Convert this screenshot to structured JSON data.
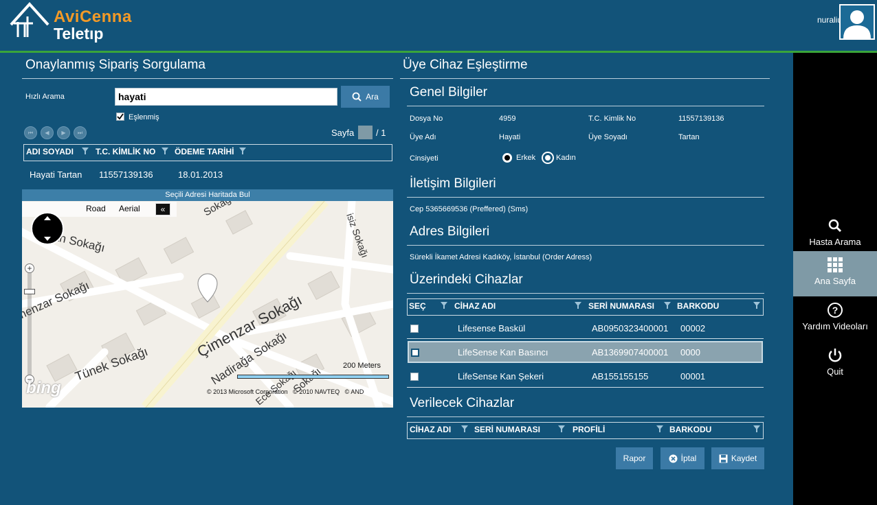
{
  "app": {
    "logo_top": "AviCenna",
    "logo_bottom": "Teletıp",
    "username": "nuraliu"
  },
  "sidebar": {
    "items": [
      {
        "label": "Hasta Arama",
        "icon": "search-icon"
      },
      {
        "label": "Ana Sayfa",
        "icon": "grid-icon",
        "active": true
      },
      {
        "label": "Yardım Videoları",
        "icon": "help-icon"
      },
      {
        "label": "Quit",
        "icon": "power-icon"
      }
    ]
  },
  "left": {
    "title": "Onaylanmış Sipariş Sorgulama",
    "quick_search_label": "Hızlı Arama",
    "search_value": "hayati",
    "search_button": "Ara",
    "matched_label": "Eşlenmiş",
    "page_label": "Sayfa",
    "page_total": "/ 1",
    "columns": [
      "ADI SOYADI",
      "T.C. KİMLİK NO",
      "ÖDEME TARİHİ"
    ],
    "rows": [
      {
        "name": "Hayati Tartan",
        "tc": "11557139136",
        "date": "18.01.2013"
      }
    ]
  },
  "map": {
    "header": "Seçili Adresi Haritada Bul",
    "road": "Road",
    "aerial": "Aerial",
    "collapse": "«",
    "streets": [
      "Çimenzar Sokağı",
      "Tünek Sokağı",
      "Nadirağa Sokağı",
      "Celtan Sokağı",
      "Cimenzar Sokağı",
      "Sokağı",
      "Sokağı",
      "isiz Sokağı",
      "Ece Sokağı"
    ],
    "scale": "200 Meters",
    "copyright": "© 2013 Microsoft Corporation   © 2010 NAVTEQ   © AND",
    "bing": "bing"
  },
  "right": {
    "title": "Üye Cihaz Eşleştirme",
    "general": {
      "title": "Genel Bilgiler",
      "dosya_label": "Dosya No",
      "dosya": "4959",
      "tc_label": "T.C. Kimlik No",
      "tc": "11557139136",
      "ad_label": "Üye Adı",
      "ad": "Hayati",
      "soyad_label": "Üye Soyadı",
      "soyad": "Tartan",
      "cins_label": "Cinsiyeti",
      "erkek": "Erkek",
      "kadin": "Kadın"
    },
    "contact": {
      "title": "İletişim Bilgileri",
      "line": "Cep  5365669536 (Preffered) (Sms)"
    },
    "address": {
      "title": "Adres Bilgileri",
      "line": "Sürekli İkamet Adresi Kadıköy, İstanbul  (Order Adress)"
    },
    "devices": {
      "title": "Üzerindeki Cihazlar",
      "columns": [
        "SEÇ",
        "CİHAZ ADI",
        "SERİ NUMARASI",
        "BARKODU"
      ],
      "rows": [
        {
          "name": "Lifesense Baskül",
          "serial": "AB0950323400001",
          "barcode": "00002"
        },
        {
          "name": "LifeSense Kan Basıncı",
          "serial": "AB1369907400001",
          "barcode": "0000"
        },
        {
          "name": "LifeSense Kan Şekeri",
          "serial": "AB155155155",
          "barcode": "00001"
        }
      ]
    },
    "to_give": {
      "title": "Verilecek Cihazlar",
      "columns": [
        "CİHAZ ADI",
        "SERİ NUMARASI",
        "PROFİLİ",
        "BARKODU"
      ]
    },
    "buttons": {
      "report": "Rapor",
      "cancel": "İptal",
      "save": "Kaydet"
    }
  }
}
